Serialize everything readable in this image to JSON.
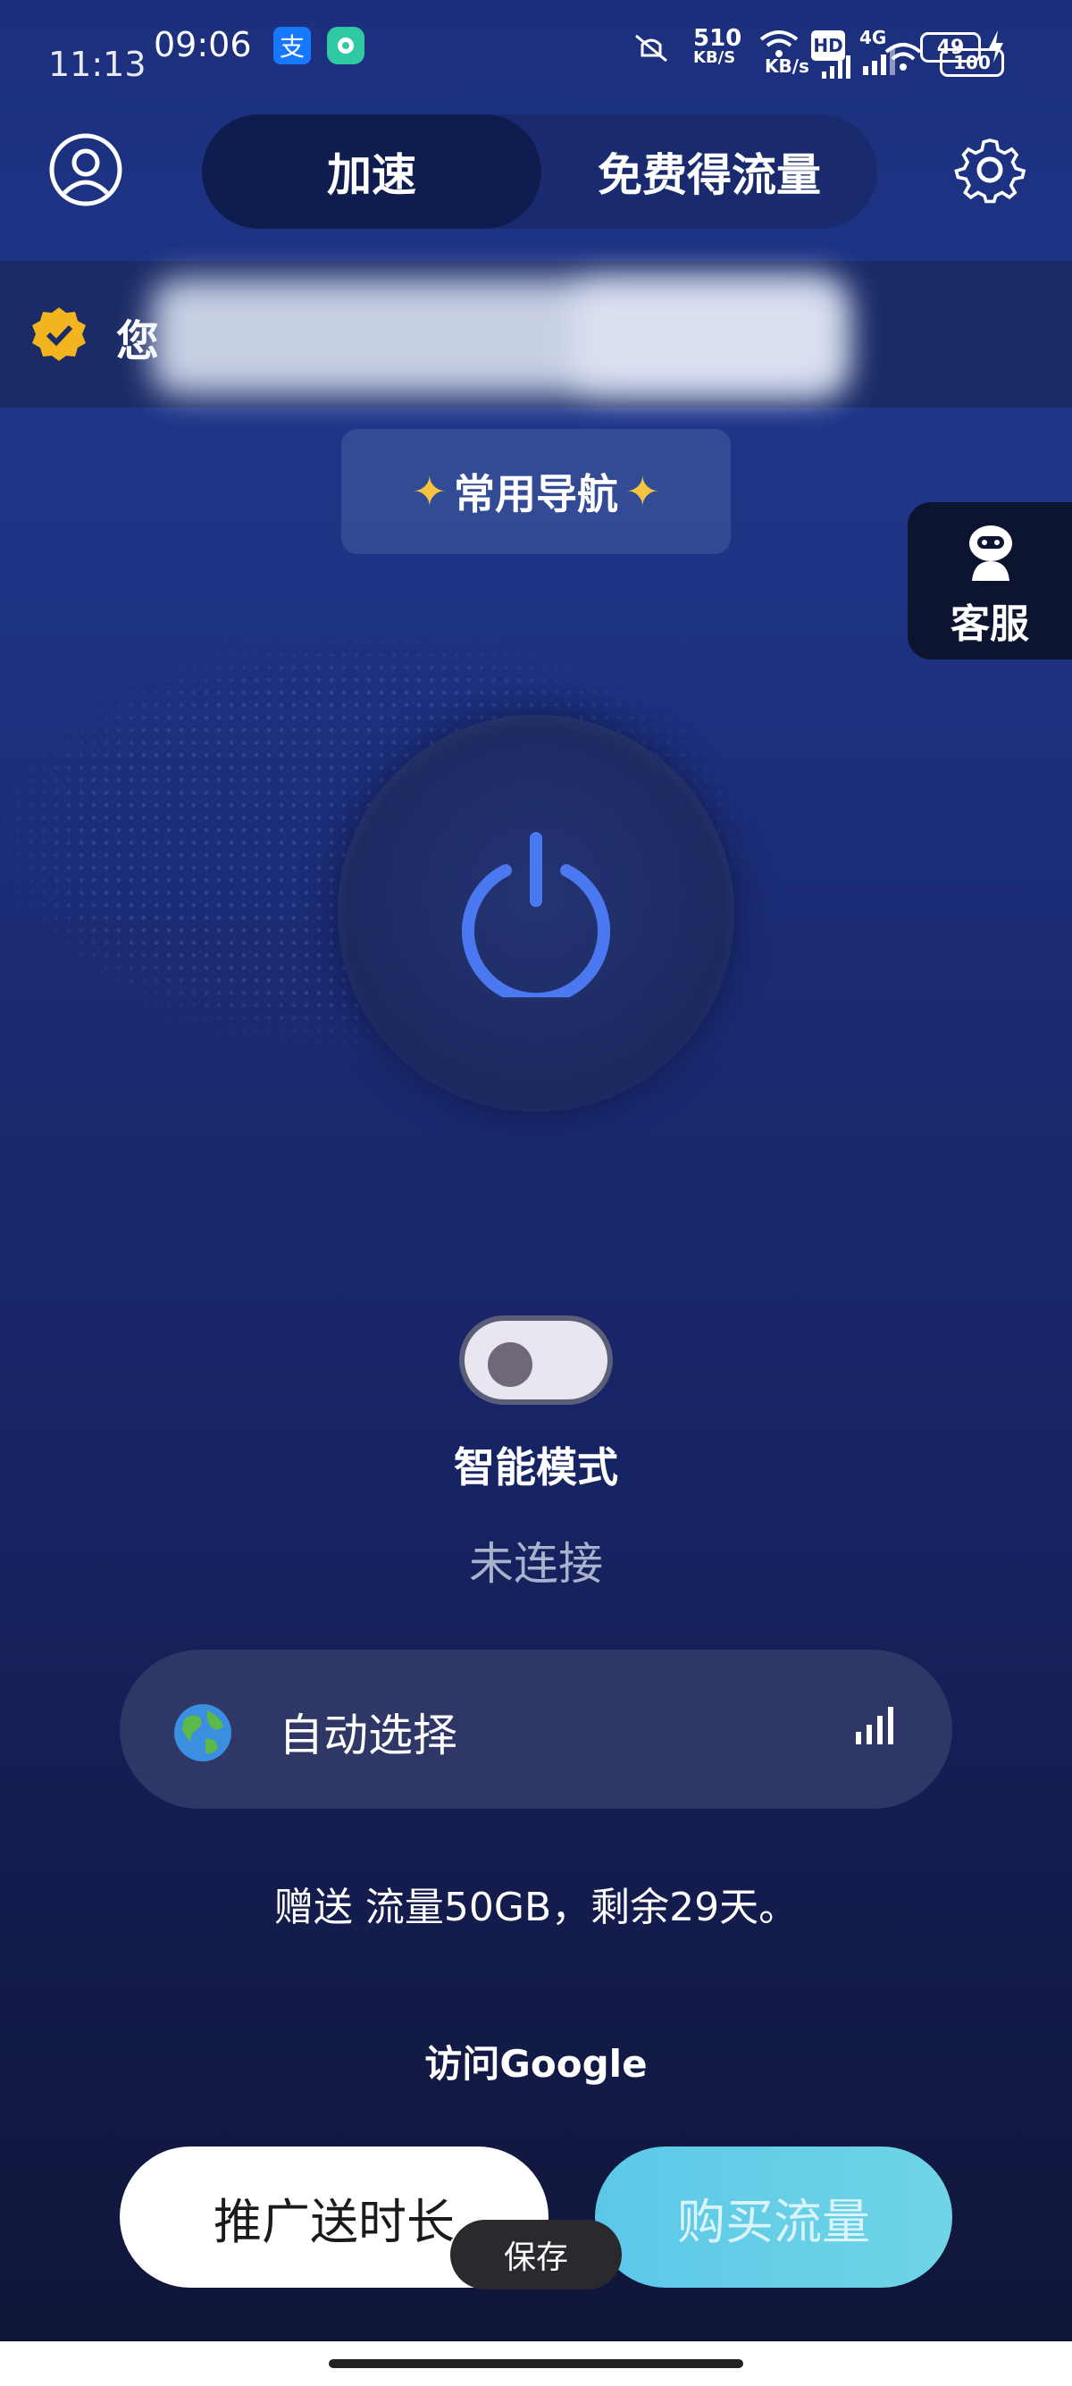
{
  "status_bar": {
    "time_back": "11:13",
    "time_front": "09:06",
    "speed_value": "510",
    "speed_unit": "KB/S",
    "speed_back": "KB/s",
    "hd": "HD",
    "net": "4G",
    "battery": "49",
    "battery_back": "100"
  },
  "header": {
    "tab_active": "加速",
    "tab_other": "免费得流量"
  },
  "notice": {
    "text_visible": "您"
  },
  "nav": {
    "label": "常用导航"
  },
  "support": {
    "label": "客服"
  },
  "mode": {
    "label": "智能模式",
    "state": "未连接"
  },
  "server": {
    "label": "自动选择"
  },
  "gift_text": "赠送 流量50GB，剩余29天。",
  "google_text": "访问Google",
  "buttons": {
    "promote": "推广送时长",
    "buy": "购买流量"
  },
  "toast": "保存",
  "colors": {
    "accent_power": "#4a78f0",
    "badge": "#f3b51f"
  }
}
